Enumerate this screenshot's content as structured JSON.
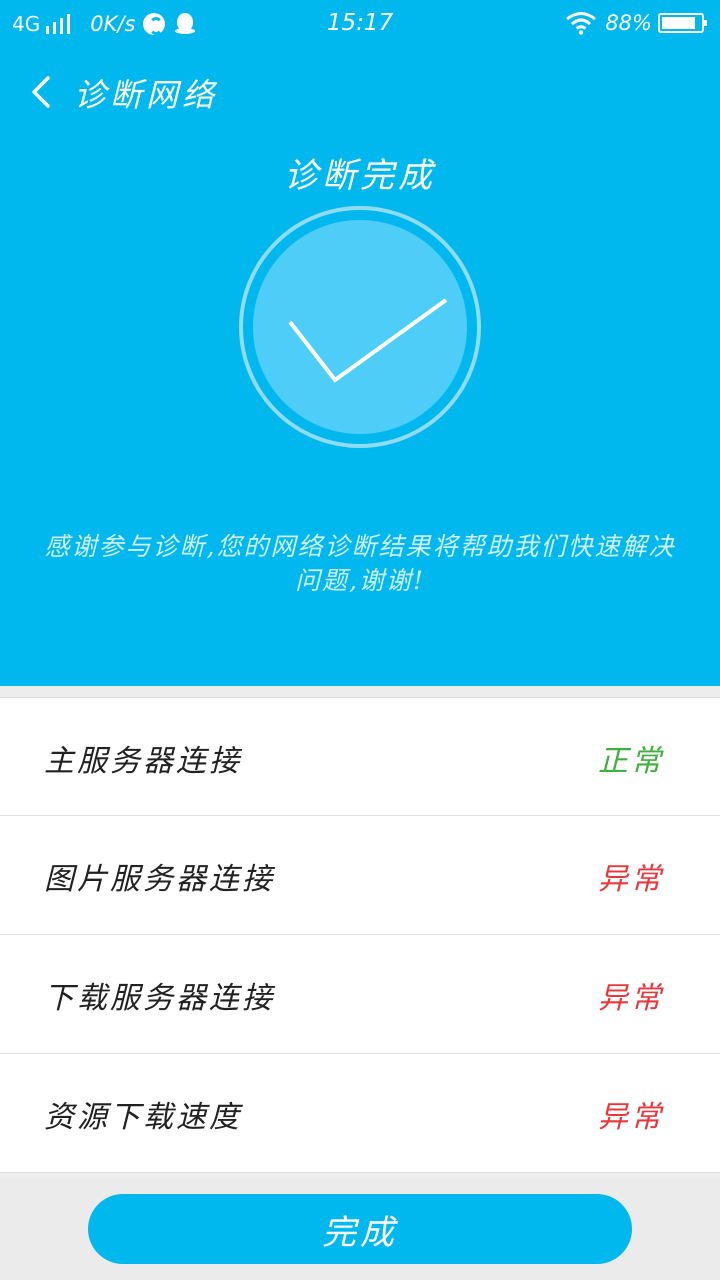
{
  "status_bar": {
    "network": "4G",
    "speed": "0K/s",
    "time": "15:17",
    "battery": "88%",
    "battery_level": 0.88,
    "icons": [
      "signal-icon",
      "sync-icon",
      "qq-icon",
      "wifi-icon",
      "battery-icon"
    ]
  },
  "nav": {
    "title": "诊断网络"
  },
  "result": {
    "title": "诊断完成",
    "message": "感谢参与诊断,您的网络诊断结果将帮助我们快速解决问题,谢谢!"
  },
  "checks": [
    {
      "label": "主服务器连接",
      "status": "正常",
      "status_color": "#3db03d"
    },
    {
      "label": "图片服务器连接",
      "status": "异常",
      "status_color": "#e8383d"
    },
    {
      "label": "下载服务器连接",
      "status": "异常",
      "status_color": "#e8383d"
    },
    {
      "label": "资源下载速度",
      "status": "异常",
      "status_color": "#e8383d"
    }
  ],
  "footer": {
    "done_label": "完成"
  },
  "colors": {
    "accent": "#00b7ee",
    "ok": "#3db03d",
    "error": "#e8383d"
  }
}
